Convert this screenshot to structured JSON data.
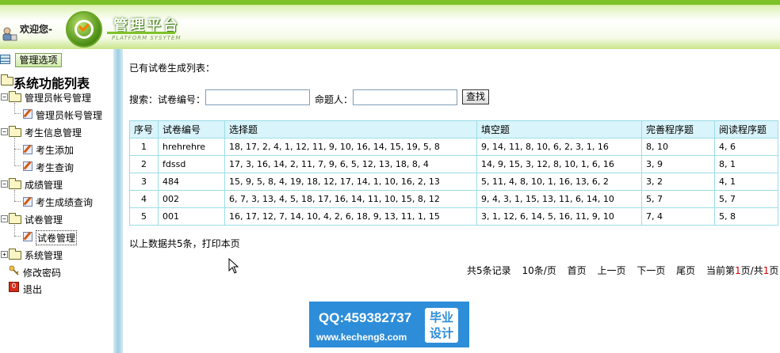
{
  "header": {
    "welcome": "欢迎您-",
    "brand_title": "管理平台",
    "brand_sub": "PLATFORM SYSYTEM"
  },
  "sidebar": {
    "head_label": "管理选项",
    "root_label": "系统功能列表",
    "groups": [
      {
        "label": "管理员帐号管理",
        "expander": "−",
        "items": [
          {
            "label": "管理员帐号管理"
          }
        ]
      },
      {
        "label": "考生信息管理",
        "expander": "−",
        "items": [
          {
            "label": "考生添加"
          },
          {
            "label": "考生查询"
          }
        ]
      },
      {
        "label": "成绩管理",
        "expander": "−",
        "items": [
          {
            "label": "考生成绩查询"
          }
        ]
      },
      {
        "label": "试卷管理",
        "expander": "−",
        "items": [
          {
            "label": "试卷管理"
          }
        ]
      },
      {
        "label": "系统管理",
        "expander": "+",
        "items": []
      }
    ],
    "extra": [
      {
        "label": "修改密码"
      },
      {
        "label": "退出"
      }
    ]
  },
  "main": {
    "list_title": "已有试卷生成列表：",
    "search": {
      "label": "搜索：",
      "exam_no_label": "试卷编号：",
      "exam_no_value": "",
      "author_label": "命题人：",
      "author_value": "",
      "button": "查找"
    },
    "table": {
      "headers": [
        "序号",
        "试卷编号",
        "选择题",
        "填空题",
        "完善程序题",
        "阅读程序题"
      ],
      "rows": [
        [
          "1",
          "hrehrehre",
          "18, 17, 2, 4, 1, 12, 11, 9, 10, 16, 14, 15, 19, 5, 8",
          "9, 14, 11, 8, 10, 6, 2, 3, 1, 16",
          "8, 10",
          "4, 6"
        ],
        [
          "2",
          "fdssd",
          "17, 3, 16, 14, 2, 11, 7, 9, 6, 5, 12, 13, 18, 8, 4",
          "14, 9, 15, 3, 12, 8, 10, 1, 6, 16",
          "3, 9",
          "8, 1"
        ],
        [
          "3",
          "484",
          "15, 9, 5, 8, 4, 19, 18, 12, 17, 14, 1, 10, 16, 2, 13",
          "5, 11, 4, 8, 10, 1, 16, 13, 6, 2",
          "3, 2",
          "4, 1"
        ],
        [
          "4",
          "002",
          "6, 7, 3, 13, 4, 5, 18, 17, 16, 14, 11, 10, 15, 8, 12",
          "9, 4, 3, 1, 15, 13, 11, 6, 14, 10",
          "5, 7",
          "5, 7"
        ],
        [
          "5",
          "001",
          "16, 17, 12, 7, 14, 10, 4, 2, 6, 18, 9, 13, 11, 1, 15",
          "3, 1, 12, 6, 14, 5, 16, 11, 9, 10",
          "7, 4",
          "5, 8"
        ]
      ]
    },
    "summary": "以上数据共5条，打印本页",
    "pager": {
      "total": "共5条记录",
      "per_page": "10条/页",
      "first": "首页",
      "prev": "上一页",
      "next": "下一页",
      "last": "尾页",
      "current_prefix": "当前第",
      "current_page": "1",
      "mid": "页/共",
      "total_pages": "1",
      "suffix": "页"
    }
  },
  "watermark": {
    "qq": "QQ:459382737",
    "url": "www.kecheng8.com",
    "badge_line1": "毕业",
    "badge_line2": "设计"
  }
}
